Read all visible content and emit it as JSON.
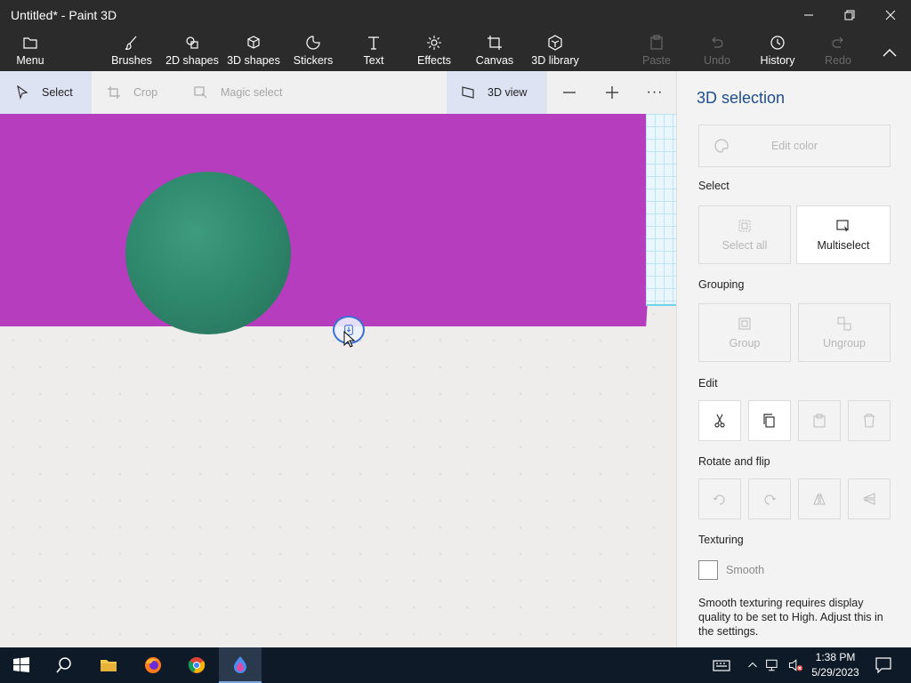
{
  "window": {
    "title": "Untitled* - Paint 3D"
  },
  "toolbar": {
    "menu": "Menu",
    "brushes": "Brushes",
    "shapes2d": "2D shapes",
    "shapes3d": "3D shapes",
    "stickers": "Stickers",
    "text": "Text",
    "effects": "Effects",
    "canvas": "Canvas",
    "library3d": "3D library",
    "paste": "Paste",
    "undo": "Undo",
    "history": "History",
    "redo": "Redo"
  },
  "subbar": {
    "select": "Select",
    "crop": "Crop",
    "magic_select": "Magic select",
    "view3d": "3D view",
    "more": "···"
  },
  "panel": {
    "title": "3D selection",
    "edit_color": "Edit color",
    "select_heading": "Select",
    "select_all": "Select all",
    "multiselect": "Multiselect",
    "grouping_heading": "Grouping",
    "group": "Group",
    "ungroup": "Ungroup",
    "edit_heading": "Edit",
    "rotate_heading": "Rotate and flip",
    "texturing_heading": "Texturing",
    "smooth": "Smooth",
    "smooth_note": "Smooth texturing requires display quality to be set to High. Adjust this in the settings."
  },
  "taskbar": {
    "time": "1:38 PM",
    "date": "5/29/2023"
  },
  "colors": {
    "canvas_object": "#b63dbe",
    "sphere": "#2f8a6d",
    "accent": "#1f4e8c"
  }
}
